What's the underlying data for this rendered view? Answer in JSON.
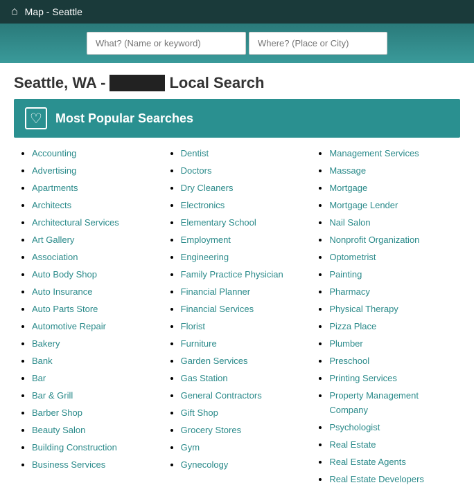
{
  "header": {
    "title": "Map - Seattle",
    "home_icon": "⌂"
  },
  "search": {
    "what_placeholder": "What? (Name or keyword)",
    "where_placeholder": "Where? (Place or City)"
  },
  "page_title": {
    "prefix": "Seattle, WA -",
    "suffix": "Local Search"
  },
  "popular_section": {
    "heart_icon": "♡",
    "title": "Most Popular Searches"
  },
  "columns": [
    {
      "items": [
        "Accounting",
        "Advertising",
        "Apartments",
        "Architects",
        "Architectural Services",
        "Art Gallery",
        "Association",
        "Auto Body Shop",
        "Auto Insurance",
        "Auto Parts Store",
        "Automotive Repair",
        "Bakery",
        "Bank",
        "Bar",
        "Bar & Grill",
        "Barber Shop",
        "Beauty Salon",
        "Building Construction",
        "Business Services"
      ]
    },
    {
      "items": [
        "Dentist",
        "Doctors",
        "Dry Cleaners",
        "Electronics",
        "Elementary School",
        "Employment",
        "Engineering",
        "Family Practice Physician",
        "Financial Planner",
        "Financial Services",
        "Florist",
        "Furniture",
        "Garden Services",
        "Gas Station",
        "General Contractors",
        "Gift Shop",
        "Grocery Stores",
        "Gym",
        "Gynecology"
      ]
    },
    {
      "items": [
        "Management Services",
        "Massage",
        "Mortgage",
        "Mortgage Lender",
        "Nail Salon",
        "Nonprofit Organization",
        "Optometrist",
        "Painting",
        "Pharmacy",
        "Physical Therapy",
        "Pizza Place",
        "Plumber",
        "Preschool",
        "Printing Services",
        "Property Management Company",
        "Psychologist",
        "Real Estate",
        "Real Estate Agents",
        "Real Estate Developers"
      ]
    }
  ]
}
